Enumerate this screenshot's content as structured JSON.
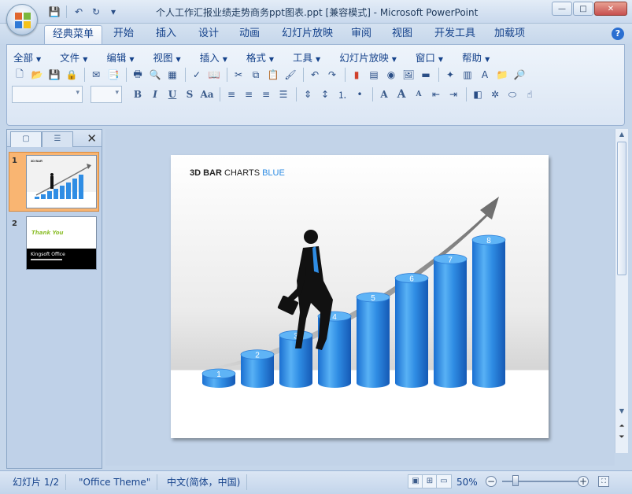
{
  "window": {
    "title": "个人工作汇报业绩走势商务ppt图表.ppt [兼容模式] - Microsoft PowerPoint",
    "minimize": "—",
    "maximize": "□",
    "close": "✕"
  },
  "qat": {
    "save": "💾",
    "undo": "↶",
    "redo": "↻",
    "more": "▾"
  },
  "ribbon_tabs": [
    "经典菜单",
    "开始",
    "插入",
    "设计",
    "动画",
    "幻灯片放映",
    "审阅",
    "视图",
    "开发工具",
    "加载项"
  ],
  "active_tab": "经典菜单",
  "help": "?",
  "menus": [
    "全部",
    "文件",
    "编辑",
    "视图",
    "插入",
    "格式",
    "工具",
    "幻灯片放映",
    "窗口",
    "帮助"
  ],
  "toolbar_row1": [
    "new-icon",
    "open-icon",
    "save-icon",
    "permission-icon",
    "print-preview-icon",
    "research-icon",
    "print-icon",
    "preview-icon",
    "table-grid-icon",
    "spelling-icon",
    "research2-icon",
    "cut-icon",
    "copy-icon",
    "paste-icon",
    "format-painter-icon",
    "undo-icon",
    "redo-icon",
    "chart-icon",
    "table-icon",
    "clipart-icon",
    "picture-icon",
    "color-icon",
    "newslide-icon",
    "layout-icon",
    "textbox-icon",
    "folder-icon",
    "zoom-icon"
  ],
  "toolbar_row2": {
    "bold": "B",
    "italic": "I",
    "underline": "U",
    "shadow": "S",
    "case": "Aa",
    "font_size_up": "A",
    "font_size_down": "A"
  },
  "thumbnails": {
    "slide1_num": "1",
    "slide2_num": "2",
    "slide2_title": "Thank You",
    "slide2_text": "Kingsoft Office"
  },
  "pane_close": "✕",
  "slide": {
    "title_bold": "3D BAR",
    "title_mid": " CHARTS ",
    "title_blue": "BLUE",
    "bar_labels": [
      "1",
      "2",
      "3",
      "4",
      "5",
      "6",
      "7",
      "8"
    ],
    "accent": "#2f8de4"
  },
  "chart_data": {
    "type": "bar",
    "categories": [
      "1",
      "2",
      "3",
      "4",
      "5",
      "6",
      "7",
      "8"
    ],
    "values": [
      1,
      2,
      3,
      4,
      5,
      6,
      7,
      8
    ],
    "title": "3D BAR CHARTS BLUE",
    "xlabel": "",
    "ylabel": "",
    "ylim": [
      0,
      8
    ]
  },
  "statusbar": {
    "slide_info": "幻灯片 1/2",
    "theme": "\"Office Theme\"",
    "language": "中文(简体，中国)",
    "zoom": "50%",
    "zoom_out": "−",
    "zoom_in": "+"
  }
}
